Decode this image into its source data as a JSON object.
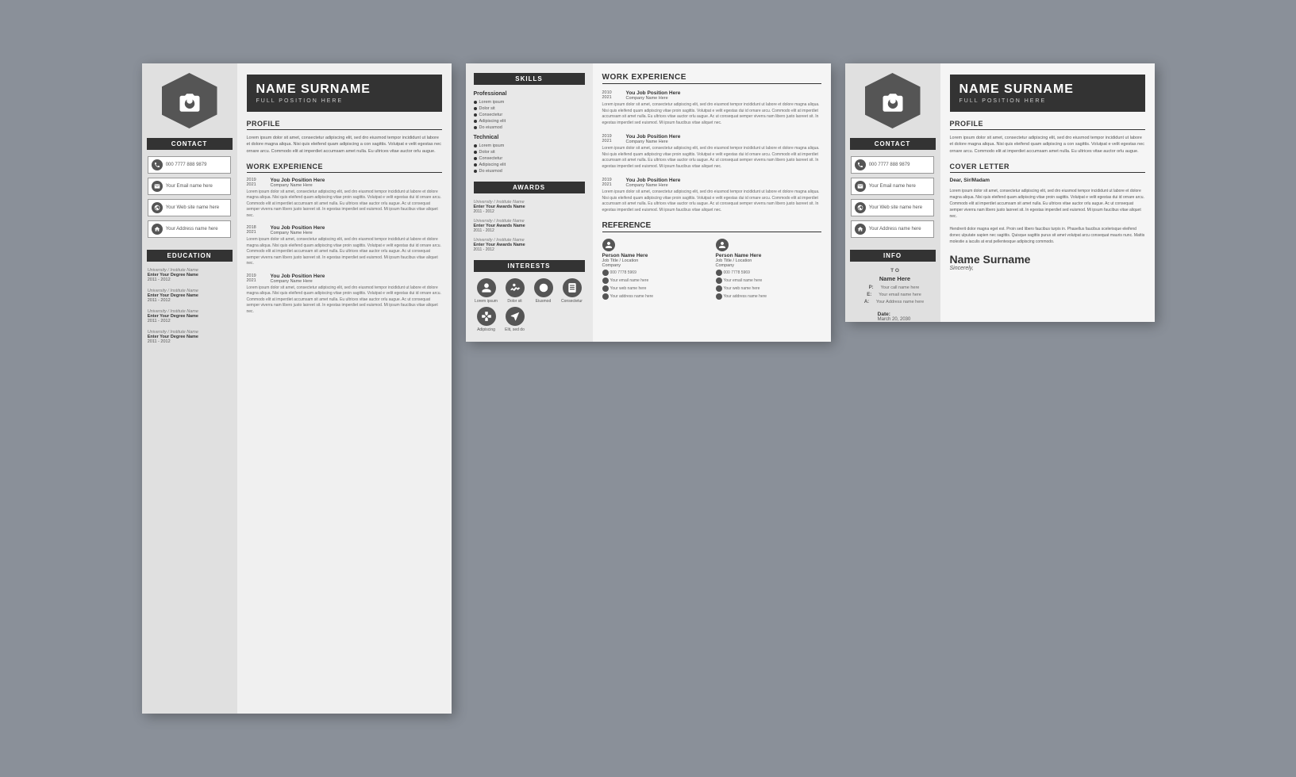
{
  "bg": "#8a9099",
  "card1": {
    "name": "NAME SURNAME",
    "position": "FULL POSITION HERE",
    "hexIcon": "camera",
    "contact": {
      "label": "CONTACT",
      "items": [
        {
          "icon": "phone",
          "text": "000 7777 888 9879"
        },
        {
          "icon": "email",
          "text": "Your Email name here"
        },
        {
          "icon": "web",
          "text": "Your Web site name here"
        },
        {
          "icon": "home",
          "text": "Your Address name here"
        }
      ]
    },
    "education": {
      "label": "EDUCATION",
      "items": [
        {
          "inst": "University / Institute Name",
          "degree": "Enter Your Degree Name",
          "years": "2011 - 2012"
        },
        {
          "inst": "University / Institute Name",
          "degree": "Enter Your Degree Name",
          "years": "2011 - 2012"
        },
        {
          "inst": "University / Institute Name",
          "degree": "Enter Your Degree Name",
          "years": "2011 - 2012"
        },
        {
          "inst": "University / Institute Name",
          "degree": "Enter Your Degree Name",
          "years": "2011 - 2012"
        }
      ]
    },
    "profile": {
      "title": "PROFILE",
      "text": "Lorem ipsum dolor sit amet, consectetur adipiscing elit, sed dro eiusmod tempor incididunt ut labore et dolore magna aliqua. Nisi quis eleifend quam adipiscing a con sagittis. Volutpat e velit egestas nec ornare arcu. Commodo elit at imperdiet accumsam amet nulla. Eu ultrices vitae auctor orlu augue."
    },
    "workExperience": {
      "title": "WORK EXPERIENCE",
      "entries": [
        {
          "years": "2019\n2021",
          "title": "You Job Position Here",
          "company": "Company Name Here",
          "desc": "Lorem ipsum dolor sit amet, consectetur adipiscing elit, sed dro eiusmod tempor incididunt ut labore et dolore magna aliqua. Nisi quis eleifend quam adipiscing vitae proin sagittis. Volutpat e velit egestas dui id ornare arcu. Commodo elit at imperdiet accumsam sit amet nulla. Eu ultrices vitae auctor orlu augue. Ac ut consequat semper viverra nam libero justo laoreet sit. In egestas imperdiet sed euismod. Mi ipsum faucibus vitae aliquet nec."
        },
        {
          "years": "2018\n2021",
          "title": "You Job Position Here",
          "company": "Company Name Here",
          "desc": "Lorem ipsum dolor sit amet, consectetur adipiscing elit, sed dro eiusmod tempor incididunt ut labore et dolore magna aliqua. Nisi quis eleifend quam adipiscing vitae proin sagittis. Volutpat e velit egestas dui id ornare arcu. Commodo elit at imperdiet accumsam sit amet nulla. Eu ultrices vitae auctor orlu augue. Ac ut consequat semper viverra nam libero justo laoreet sit. In egestas imperdiet sed euismod. Mi ipsum faucibus vitae aliquet nec."
        },
        {
          "years": "2019\n2021",
          "title": "You Job Position Here",
          "company": "Company Name Here",
          "desc": "Lorem ipsum dolor sit amet, consectetur adipiscing elit, sed dro eiusmod tempor incididunt ut labore et dolore magna aliqua. Nisi quis eleifend quam adipiscing vitae proin sagittis. Volutpat e velit egestas dui id ornare arcu. Commodo elit at imperdiet accumsam sit amet nulla. Eu ultrices vitae auctor orlu augue. Ac ut consequat semper viverra nam libero justo laoreet sit. In egestas imperdiet sed euismod. Mi ipsum faucibus vitae aliquet nec."
        }
      ]
    }
  },
  "card2": {
    "skills": {
      "label": "SKILLS",
      "professional": {
        "title": "Professional",
        "items": [
          "Lorem ipsum",
          "Dolor sit",
          "Consectetur",
          "Adipiscing elit",
          "Do eiusmod"
        ]
      },
      "technical": {
        "title": "Technical",
        "items": [
          "Lorem ipsum",
          "Dolor sit",
          "Consectetur",
          "Adipiscing elit",
          "Do eiusmod"
        ]
      }
    },
    "awards": {
      "label": "AWARDS",
      "entries": [
        {
          "inst": "University / Institute Name",
          "name": "Enter Your Awards Name",
          "years": "2011 - 2012"
        },
        {
          "inst": "University / Institute Name",
          "name": "Enter Your Awards Name",
          "years": "2011 - 2012"
        },
        {
          "inst": "University / Institute Name",
          "name": "Enter Your Awards Name",
          "years": "2011 - 2012"
        }
      ]
    },
    "interests": {
      "label": "INTERESTS",
      "items": [
        "Lorem ipsum",
        "Dolor sit",
        "Eiusmod",
        "Consectetur",
        "Adipiscing",
        "Elit, sed do"
      ]
    },
    "workExperience": {
      "title": "WORK EXPERIENCE",
      "entries": [
        {
          "years": "2010\n2021",
          "title": "You Job Position Here",
          "company": "Company Name Here",
          "desc": "Lorem ipsum dolor sit amet, consectetur adipiscing elit, sed dro eiusmod tempor incididunt ut labore et dolore magna aliqua. Nisi quis eleifend quam adipiscing vitae proin sagittis. Volutpat e velit egestas dui id ornare arcu. Commodo elit at imperdiet accumsam sit amet nulla. Eu ultrices vitae auctor orlu augue. Ac ut consequat semper viverra nam libero justo laoreet sit. In egestas imperdiet sed euismod. Mi ipsum faucibus vitae aliquet nec."
        },
        {
          "years": "2019\n2021",
          "title": "You Job Position Here",
          "company": "Company Name Here",
          "desc": "Lorem ipsum dolor sit amet, consectetur adipiscing elit, sed dro eiusmod tempor incididunt ut labore et dolore magna aliqua. Nisi quis eleifend quam adipiscing vitae proin sagittis. Volutpat e velit egestas dui id ornare arcu. Commodo elit at imperdiet accumsam sit amet nulla. Eu ultrices vitae auctor orlu augue. Ac ut consequat semper viverra nam libero justo laoreet sit. In egestas imperdiet sed euismod. Mi ipsum faucibus vitae aliquet nec."
        },
        {
          "years": "2019\n2021",
          "title": "You Job Position Here",
          "company": "Company Name Here",
          "desc": "Lorem ipsum dolor sit amet, consectetur adipiscing elit, sed dro eiusmod tempor incididunt ut labore et dolore magna aliqua. Nisi quis eleifend quam adipiscing vitae proin sagittis. Volutpat e velit egestas dui id ornare arcu. Commodo elit at imperdiet accumsam sit amet nulla. Eu ultrices vitae auctor orlu augue. Ac ut consequat semper viverra nam libero justo laoreet sit. In egestas imperdiet sed euismod. Mi ipsum faucibus vitae aliquet nec."
        }
      ]
    },
    "reference": {
      "title": "REFERENCE",
      "persons": [
        {
          "name": "Person Name Here",
          "jobtitle": "Job Title / Location",
          "company": "Company",
          "phone": "000 7778 5969",
          "email": "Your email name here",
          "web": "Your web name here",
          "address": "Your address name here"
        },
        {
          "name": "Person Name Here",
          "jobtitle": "Job Title / Location",
          "company": "Company",
          "phone": "000 7778 5969",
          "email": "Your email name here",
          "web": "Your web name here",
          "address": "Your address name here"
        }
      ]
    }
  },
  "card3": {
    "name": "NAME SURNAME",
    "position": "FULL POSITION HERE",
    "hexIcon": "camera",
    "contact": {
      "label": "CONTACT",
      "items": [
        {
          "icon": "phone",
          "text": "000 7777 888 9879"
        },
        {
          "icon": "email",
          "text": "Your Email name here"
        },
        {
          "icon": "web",
          "text": "Your Web site name here"
        },
        {
          "icon": "home",
          "text": "Your Address name here"
        }
      ]
    },
    "info": {
      "label": "INFO",
      "to": "T O",
      "name": "Name Here",
      "fields": [
        {
          "key": "P:",
          "val": "Your call name here"
        },
        {
          "key": "E:",
          "val": "Your email name here"
        },
        {
          "key": "A:",
          "val": "Your Address name here"
        }
      ],
      "date": {
        "label": "Date:",
        "value": "March 20, 2030"
      }
    },
    "profile": {
      "title": "PROFILE",
      "text": "Lorem ipsum dolor sit amet, consectetur adipiscing elit, sed dro eiusmod tempor incididunt ut labore et dolore magna aliqua. Nisi quis eleifend quam adipiscing a con sagittis. Volutpat e velit egestas nec ornare arcu. Commodo elit at imperdiet accumsam amet nulla. Eu ultrices vitae auctor orlu augue."
    },
    "coverLetter": {
      "title": "COVER LETTER",
      "greeting": "Dear, Sir/Madam",
      "body": "Lorem ipsum dolor sit amet, consectetur adipiscing elit, sed dro eiusmod tempor incididunt ut labore et dolore magna aliqua. Nisi quis eleifend quam adipiscing vitae proin sagittis. Volutpat e velit egestas dui id ornare arcu. Commodo elit at imperdiet accumsam sit amet nulla. Eu ultrices vitae auctor orlu augue. Ac ut consequat semper viverra nam libero justo laoreet sit. In egestas imperdiet sed euismod. Mi ipsum faucibus vitae aliquet nec.\n\nHendrerit dolor magna eget est. Proin sed libero faucibus turpis in. Phasellus faucibus scelerisque eleifend donec ulputate sapien nec sagittis. Quisque sagittis purus sit amet volutpat arcu consequat mauris nunc. Mattis molestie a iaculis at erat pellentesque adipiscing commodo.",
      "signature": "Name Surname",
      "closing": "Sincerely,"
    }
  }
}
